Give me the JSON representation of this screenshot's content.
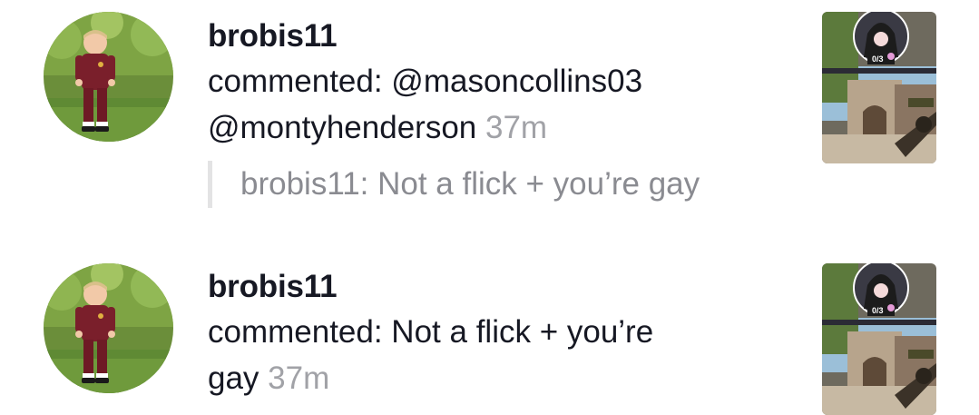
{
  "notifications": [
    {
      "username": "brobis11",
      "line1": "commented: @masoncollins03",
      "line2": "@montyhenderson",
      "time": "37m",
      "quote": "brobis11: Not a flick + you’re gay",
      "thumb_score": "0/3"
    },
    {
      "username": "brobis11",
      "line1": "commented: Not a flick + you’re",
      "line2": "gay",
      "time": "37m",
      "thumb_score": "0/3"
    }
  ],
  "colors": {
    "text_primary": "#161823",
    "text_secondary": "#a1a2a7",
    "quote_text": "#8a8b91",
    "quote_bar": "#e3e3e4"
  }
}
